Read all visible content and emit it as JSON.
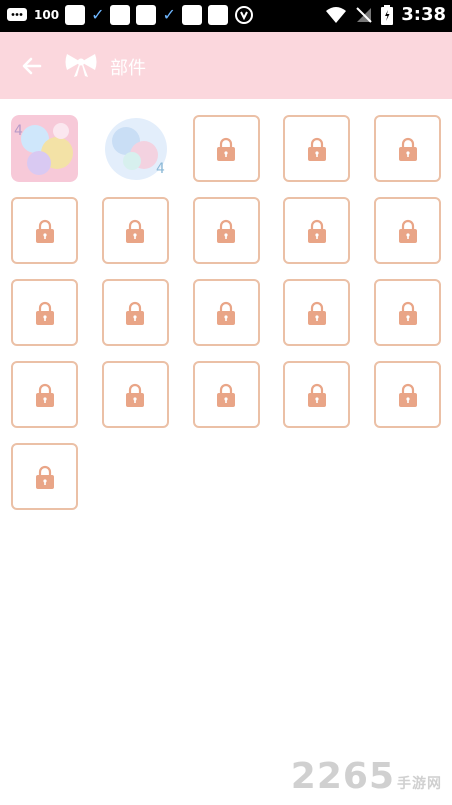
{
  "status_bar": {
    "left_text": "100",
    "time": "3:38",
    "icons": [
      "message-icon",
      "check-icon",
      "check-icon",
      "shield-icon",
      "wifi-icon",
      "signal-off-icon",
      "battery-icon"
    ]
  },
  "header": {
    "title": "部件",
    "back_icon": "arrow-left-icon",
    "logo_icon": "bow-icon",
    "background": "#fbd7dd"
  },
  "parts": {
    "unlocked_count": 2,
    "locked_count": 19,
    "lock_color": "#e9a587",
    "border_color": "#ebc0a6"
  },
  "watermark": {
    "number": "2265",
    "suffix": "手游网"
  }
}
